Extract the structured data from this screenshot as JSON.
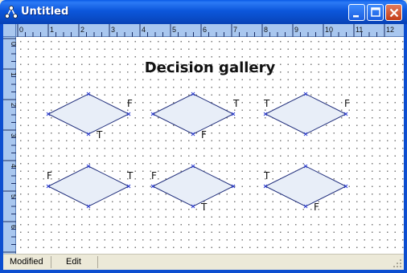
{
  "window": {
    "title": "Untitled"
  },
  "titlebar_buttons": {
    "minimize": "minimize-icon",
    "maximize": "maximize-icon",
    "close": "close-icon"
  },
  "page_title": "Decision gallery",
  "ruler": {
    "horizontal_labels": [
      "0",
      "1",
      "2",
      "3",
      "4",
      "5",
      "6",
      "7",
      "8",
      "9",
      "10",
      "11",
      "12"
    ],
    "vertical_labels": [
      "0",
      "1",
      "2",
      "3",
      "4",
      "5",
      "6"
    ]
  },
  "diamonds": [
    {
      "labels": [
        "F",
        "T"
      ]
    },
    {
      "labels": [
        "T",
        "F"
      ]
    },
    {
      "labels": [
        "T",
        "F"
      ]
    },
    {
      "labels": [
        "F",
        "T"
      ]
    },
    {
      "labels": [
        "F",
        "T"
      ]
    },
    {
      "labels": [
        "T",
        "F"
      ]
    }
  ],
  "statusbar": {
    "mode": "Modified",
    "state": "Edit"
  },
  "colors": {
    "diamond_fill": "#e8eef8",
    "diamond_stroke": "#1d2b7a",
    "handle": "#2a3bd0",
    "ruler": "#a9c7ef"
  }
}
